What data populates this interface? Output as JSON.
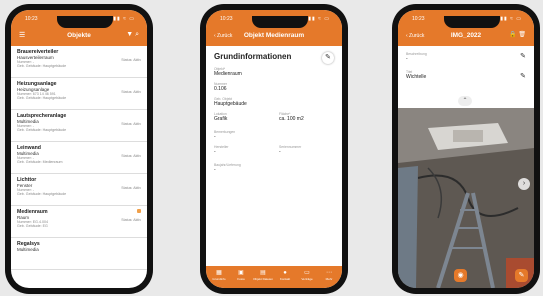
{
  "phone1": {
    "time": "10:23",
    "signal": "▮▮▮ ≈ ▭",
    "title": "Objekte",
    "items": [
      {
        "title": "Brauereiverteiler",
        "subtitle": "Hausverteilerraum",
        "meta1": "Nummer: -",
        "meta2": "Bemerkungen: -",
        "meta3": "Geb. Gebäude: Hauptgebäude",
        "status": "Status: Aktiv"
      },
      {
        "title": "Heizungsanlage",
        "subtitle": "Heizungsanlage",
        "meta1": "Nummer: 673 14 46 591",
        "meta2": "Bemerkungen: -",
        "meta3": "Geb. Gebäude: Hauptgebäude",
        "status": "Status: Aktiv"
      },
      {
        "title": "Lautsprecheranlage",
        "subtitle": "Multimedia",
        "meta1": "Nummer: -",
        "meta2": "Bemerkungen: -",
        "meta3": "Geb. Gebäude: Hauptgebäude",
        "status": "Status: Aktiv"
      },
      {
        "title": "Leinwand",
        "subtitle": "Multimedia",
        "meta1": "Nummer: -",
        "meta2": "Bemerkungen: -",
        "meta3": "Geb. Gebäude: Medienraum",
        "status": "Status: Aktiv"
      },
      {
        "title": "Lichttor",
        "subtitle": "Fenster",
        "meta1": "Nummer: -",
        "meta2": "Bemerkungen: -",
        "meta3": "Geb. Gebäude: Hauptgebäude",
        "status": "Status: Aktiv"
      },
      {
        "title": "Medienraum",
        "subtitle": "Raum",
        "meta1": "Nummer: EG.4.004",
        "meta2": "Bemerkungen: -",
        "meta3": "Geb. Gebäude: EG",
        "status": "Status: Aktiv"
      },
      {
        "title": "Regalsys",
        "subtitle": "Multimedia",
        "meta1": "",
        "meta2": "",
        "meta3": "",
        "status": ""
      }
    ]
  },
  "phone2": {
    "time": "10:23",
    "signal": "▮▮▮ ≈ ▭",
    "back": "‹ Zurück",
    "title": "Objekt Medienraum",
    "heading": "Grundinformationen",
    "fields": {
      "name_label": "Objekt*",
      "name_value": "Medienraum",
      "number_label": "Nummer",
      "number_value": "0.106",
      "building_label": "Geb. Objekt",
      "building_value": "Hauptgebäude",
      "location_label": "Lokation",
      "location_value": "Grafik",
      "area_label": "Fläche*",
      "area_value": "ca. 100 m2",
      "remarks_label": "Bemerkungen",
      "remarks_value": "-",
      "manufacturer_label": "Hersteller",
      "manufacturer_value": "-",
      "serial_label": "Seriennummer",
      "serial_value": "-",
      "install_label": "Baujahr/Lieferung",
      "install_value": "-"
    },
    "tabs": [
      "Grundinfo",
      "Fotos",
      "Objekt Dateien",
      "Kontakt",
      "Verträge",
      "Mehr"
    ]
  },
  "phone3": {
    "time": "10:23",
    "signal": "▮▮▮ ≈ ▭",
    "back": "‹ Zurück",
    "title": "IMG_2022",
    "field1_label": "Beschreibung",
    "field1_value": "-",
    "field2_label": "Titel",
    "field2_value": "Wichtelle"
  }
}
